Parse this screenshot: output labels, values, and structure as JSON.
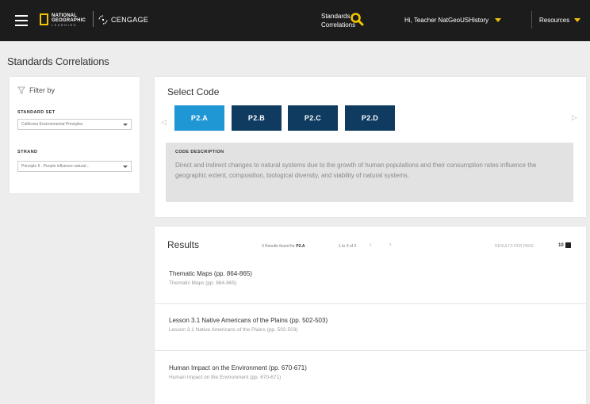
{
  "header": {
    "brand": {
      "name_line1": "NATIONAL",
      "name_line2": "GEOGRAPHIC",
      "sub": "LEARNING",
      "partner": "CENGAGE"
    },
    "standards_link_line1": "Standards",
    "standards_link_line2": "Correlations",
    "user_label": "Hi, Teacher NatGeoUSHistory",
    "resources_label": "Resources",
    "accent_color": "#f5c400"
  },
  "page_title": "Standards Correlations",
  "filter": {
    "heading": "Filter by",
    "standard_set_label": "STANDARD SET",
    "standard_set_value": "California Environmental Principles",
    "strand_label": "STRAND",
    "strand_value": "Principle II - People influence natural..."
  },
  "select_code": {
    "title": "Select Code",
    "codes": [
      "P2.A",
      "P2.B",
      "P2.C",
      "P2.D"
    ],
    "selected": "P2.A",
    "description_label": "CODE DESCRIPTION",
    "description": "Direct and indirect changes to natural systems due to the growth of human populations and their consumption rates influence the geographic extent, composition, biological diversity, and viability of natural systems."
  },
  "results": {
    "title": "Results",
    "count_text": "3 Results found for",
    "count_code": "P2.A",
    "range": "1 to 3 of 3",
    "prev": "‹",
    "next": "›",
    "per_page_label": "RESULTS PER PAGE",
    "per_page_value": "10",
    "items": [
      {
        "title": "Thematic Maps (pp. 864-865)",
        "sub": "Thematic Maps (pp. 864-865)"
      },
      {
        "title": "Lesson 3.1 Native Americans of the Plains (pp. 502-503)",
        "sub": "Lesson 3.1 Native Americans of the Plains (pp. 502-503)"
      },
      {
        "title": "Human Impact on the Environment (pp. 670-671)",
        "sub": "Human Impact on the Environment (pp. 670-671)"
      }
    ]
  }
}
